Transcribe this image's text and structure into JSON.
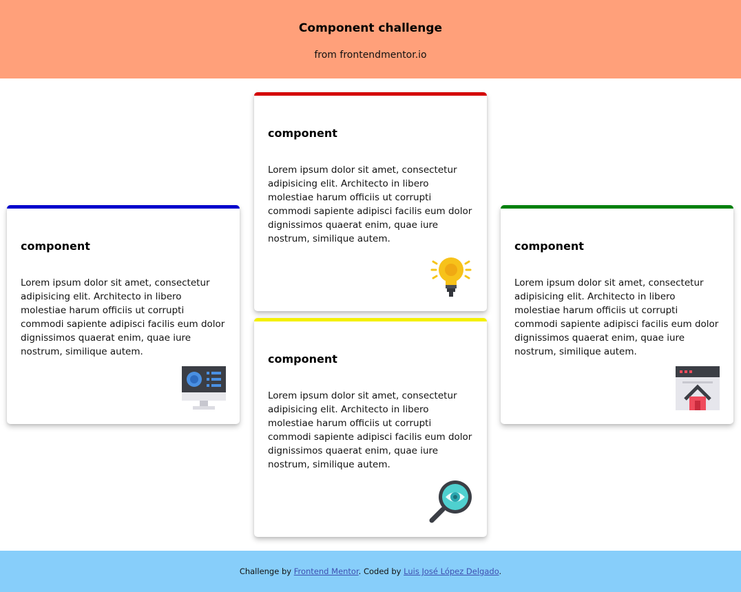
{
  "header": {
    "title": "Component challenge",
    "subtitle": "from frontendmentor.io"
  },
  "cards": [
    {
      "title": "component",
      "text": "Lorem ipsum dolor sit amet, consectetur adipisicing elit. Architecto in libero molestiae harum officiis ut corrupti commodi sapiente adipisci facilis eum dolor dignissimos quaerat enim, quae iure nostrum, similique autem.",
      "accent_color": "#0000cc",
      "icon": "monitor-dashboard-icon"
    },
    {
      "title": "component",
      "text": "Lorem ipsum dolor sit amet, consectetur adipisicing elit. Architecto in libero molestiae harum officiis ut corrupti commodi sapiente adipisci facilis eum dolor dignissimos quaerat enim, quae iure nostrum, similique autem.",
      "accent_color": "#d40000",
      "icon": "lightbulb-icon"
    },
    {
      "title": "component",
      "text": "Lorem ipsum dolor sit amet, consectetur adipisicing elit. Architecto in libero molestiae harum officiis ut corrupti commodi sapiente adipisci facilis eum dolor dignissimos quaerat enim, quae iure nostrum, similique autem.",
      "accent_color": "#f4f000",
      "icon": "magnifier-eye-icon"
    },
    {
      "title": "component",
      "text": "Lorem ipsum dolor sit amet, consectetur adipisicing elit. Architecto in libero molestiae harum officiis ut corrupti commodi sapiente adipisci facilis eum dolor dignissimos quaerat enim, quae iure nostrum, similique autem.",
      "accent_color": "#00800b",
      "icon": "browser-home-icon"
    }
  ],
  "footer": {
    "prefix": "Challenge by ",
    "link1_label": "Frontend Mentor",
    "middle": ". Coded by ",
    "link2_label": "Luis José López Delgado",
    "suffix": "."
  },
  "colors": {
    "header_bg": "#ffa07a",
    "footer_bg": "#87cefa",
    "link": "#3e4fb0"
  }
}
